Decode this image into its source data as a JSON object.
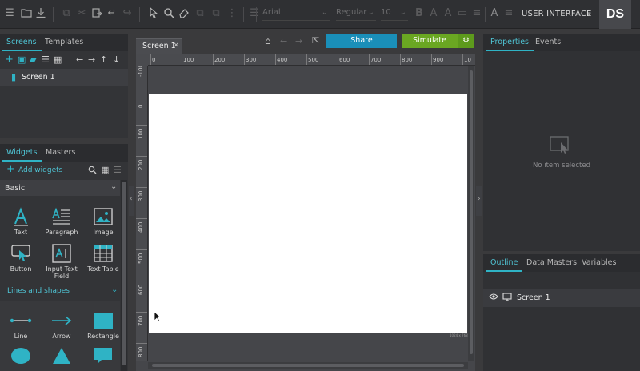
{
  "toolbar": {
    "font_family": "Arial",
    "font_style": "Regular",
    "font_size": "10",
    "workspace_label": "USER INTERFACE",
    "user_initials": "DS"
  },
  "left_top": {
    "tabs": [
      {
        "label": "Screens",
        "active": true
      },
      {
        "label": "Templates",
        "active": false
      }
    ],
    "screens": [
      {
        "label": "Screen 1"
      }
    ]
  },
  "left_bottom": {
    "tabs": [
      {
        "label": "Widgets",
        "active": true
      },
      {
        "label": "Masters",
        "active": false
      }
    ],
    "add_label": "Add widgets",
    "category": "Basic",
    "widgets": [
      {
        "label": "Text",
        "icon": "text-icon"
      },
      {
        "label": "Paragraph",
        "icon": "paragraph-icon"
      },
      {
        "label": "Image",
        "icon": "image-icon"
      },
      {
        "label": "Button",
        "icon": "button-icon"
      },
      {
        "label": "Input Text Field",
        "icon": "input-text-icon"
      },
      {
        "label": "Text Table",
        "icon": "table-icon"
      }
    ],
    "section2": "Lines and shapes",
    "shapes": [
      {
        "label": "Line",
        "icon": "line-icon"
      },
      {
        "label": "Arrow",
        "icon": "arrow-icon"
      },
      {
        "label": "Rectangle",
        "icon": "rectangle-icon"
      },
      {
        "label": "",
        "icon": "ellipse-icon"
      },
      {
        "label": "",
        "icon": "triangle-icon"
      },
      {
        "label": "",
        "icon": "callout-icon"
      }
    ]
  },
  "canvas": {
    "tab_label": "Screen 1",
    "share_label": "Share",
    "simulate_label": "Simulate",
    "ruler_top": [
      "0",
      "100",
      "200",
      "300",
      "400",
      "500",
      "600",
      "700",
      "800",
      "900",
      "10"
    ],
    "ruler_left": [
      "-100",
      "0",
      "100",
      "200",
      "300",
      "400",
      "500",
      "600",
      "700",
      "800"
    ],
    "page_size_label": "1024 x 768"
  },
  "right": {
    "tabs": [
      {
        "label": "Properties",
        "active": true
      },
      {
        "label": "Events",
        "active": false
      }
    ],
    "empty_label": "No item selected",
    "outline_tabs": [
      {
        "label": "Outline",
        "active": true
      },
      {
        "label": "Data Masters",
        "active": false
      },
      {
        "label": "Variables",
        "active": false
      }
    ],
    "outline_items": [
      {
        "label": "Screen 1"
      }
    ]
  },
  "colors": {
    "accent": "#2fb3c5",
    "share": "#1a8fb9",
    "simulate": "#6aa722"
  }
}
